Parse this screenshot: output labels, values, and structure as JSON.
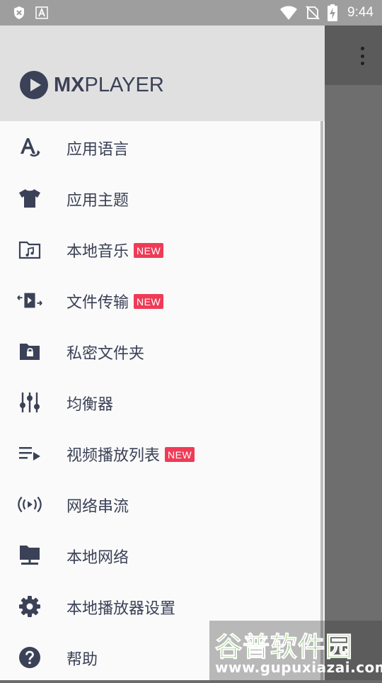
{
  "status_bar": {
    "time": "9:44",
    "left_icons": [
      "shield-x-icon",
      "font-a-icon"
    ],
    "right_icons": [
      "wifi-icon",
      "no-sim-icon",
      "battery-charging-icon"
    ]
  },
  "background_app": {
    "toolbar_icon": "overflow-menu-icon"
  },
  "drawer": {
    "logo": {
      "mx": "MX",
      "player": "PLAYER"
    },
    "items": [
      {
        "label": "应用语言",
        "icon": "language-icon",
        "badge": ""
      },
      {
        "label": "应用主题",
        "icon": "shirt-icon",
        "badge": ""
      },
      {
        "label": "本地音乐",
        "icon": "music-folder-icon",
        "badge": "NEW"
      },
      {
        "label": "文件传输",
        "icon": "file-transfer-icon",
        "badge": "NEW"
      },
      {
        "label": "私密文件夹",
        "icon": "private-folder-icon",
        "badge": ""
      },
      {
        "label": "均衡器",
        "icon": "equalizer-icon",
        "badge": ""
      },
      {
        "label": "视频播放列表",
        "icon": "playlist-icon",
        "badge": "NEW"
      },
      {
        "label": "网络串流",
        "icon": "stream-icon",
        "badge": ""
      },
      {
        "label": "本地网络",
        "icon": "network-folder-icon",
        "badge": ""
      },
      {
        "label": "本地播放器设置",
        "icon": "gear-icon",
        "badge": ""
      },
      {
        "label": "帮助",
        "icon": "help-icon",
        "badge": ""
      }
    ]
  },
  "watermark": {
    "title": "谷普软件园",
    "url": "www.gupuxiazai.com"
  },
  "colors": {
    "icon": "#3b4157",
    "badge": "#ef3b56",
    "drawer_bg": "#fafafa",
    "header_bg": "#e0e0e0"
  }
}
